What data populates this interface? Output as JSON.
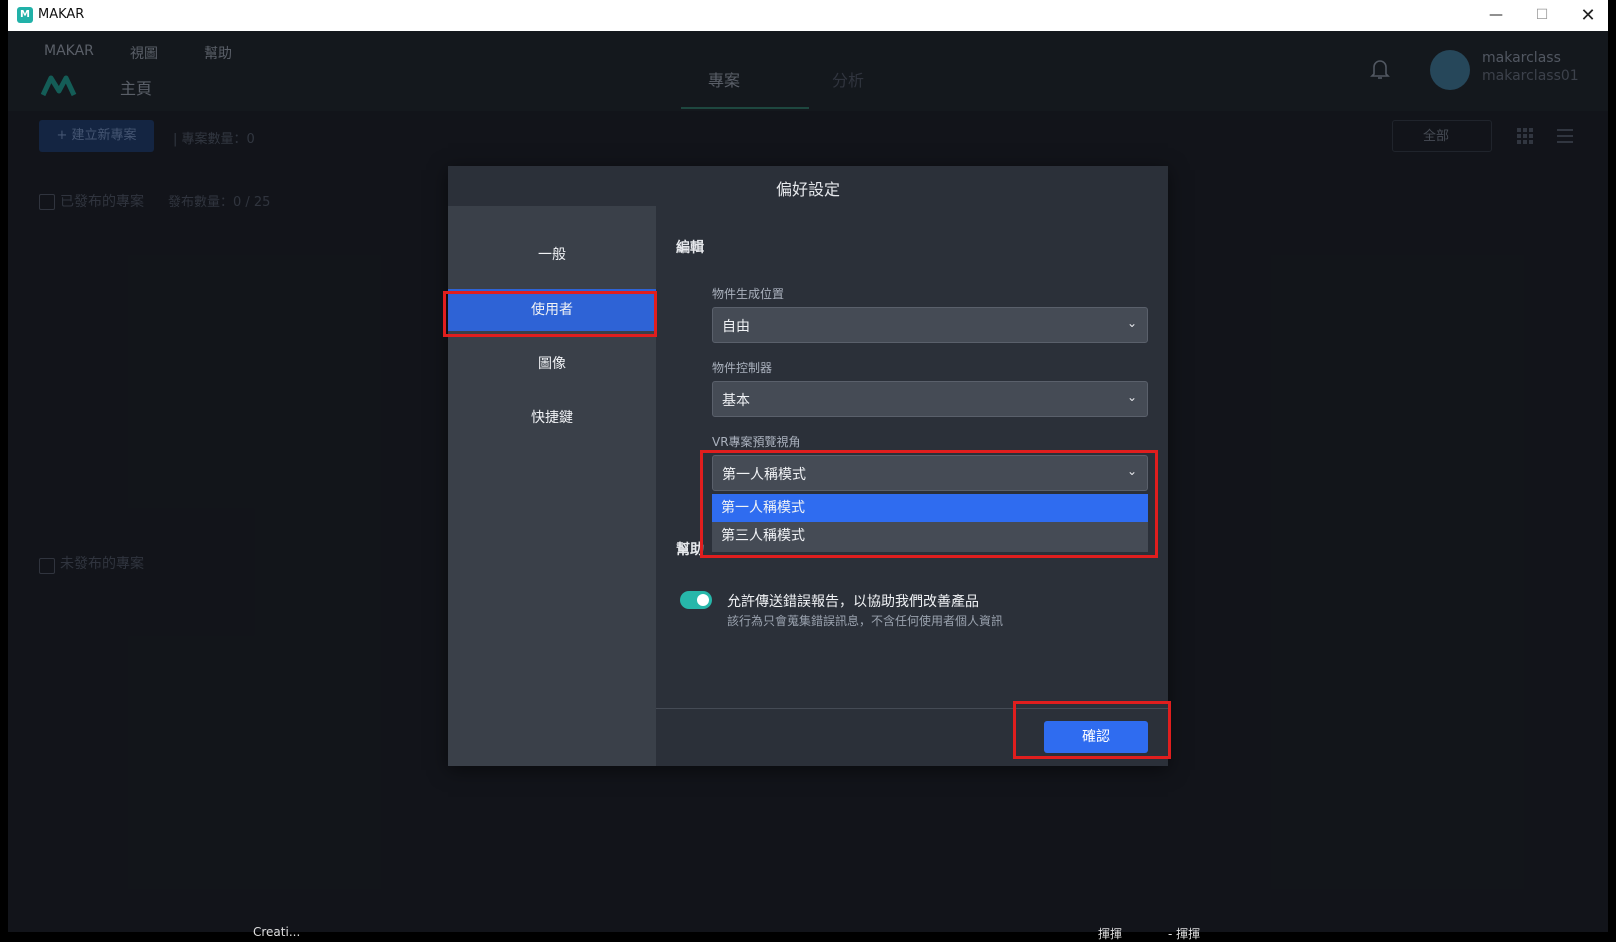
{
  "window": {
    "title": "MAKAR",
    "app_icon": "makar-app-icon",
    "minimize": "—",
    "maximize": "☐",
    "close": "✕"
  },
  "topbar": {
    "menu": [
      "MAKAR",
      "視圖",
      "幫助"
    ],
    "home_label": "主頁",
    "tabs": [
      "專案",
      "分析"
    ],
    "user_name": "makarclass",
    "user_id": "makarclass01"
  },
  "toolbar": {
    "new_project": "+ 建立新專案",
    "project_count": "| 專案數量：0",
    "filter_value": "全部"
  },
  "sections": {
    "published": "已發布的專案",
    "published_count": "發布數量：0 / 25",
    "unpublished": "未發布的專案"
  },
  "dialog": {
    "title": "偏好設定",
    "side_items": [
      "一般",
      "使用者",
      "圖像",
      "快捷鍵"
    ],
    "active_side_item": "使用者",
    "edit_group": "編輯",
    "spawn_position_label": "物件生成位置",
    "spawn_position_value": "自由",
    "controller_label": "物件控制器",
    "controller_value": "基本",
    "vr_view_label": "VR專案預覽視角",
    "vr_view_value": "第一人稱模式",
    "vr_view_options": [
      "第一人稱模式",
      "第三人稱模式"
    ],
    "help_group_partial": "幫助",
    "error_report_label": "允許傳送錯誤報告，以協助我們改善產品",
    "error_report_note": "該行為只會蒐集錯誤訊息，不含任何使用者個人資訊",
    "error_report_enabled": true,
    "confirm": "確認"
  },
  "taskbar": {
    "left_text": "Creati...",
    "mid_text_1": "揮揮",
    "mid_text_2": "- 揮揮"
  },
  "colors": {
    "accent": "#2f6cf0",
    "active_side": "#2e63d6",
    "toggle": "#27b7aa",
    "highlight_box": "#e01e1e"
  }
}
